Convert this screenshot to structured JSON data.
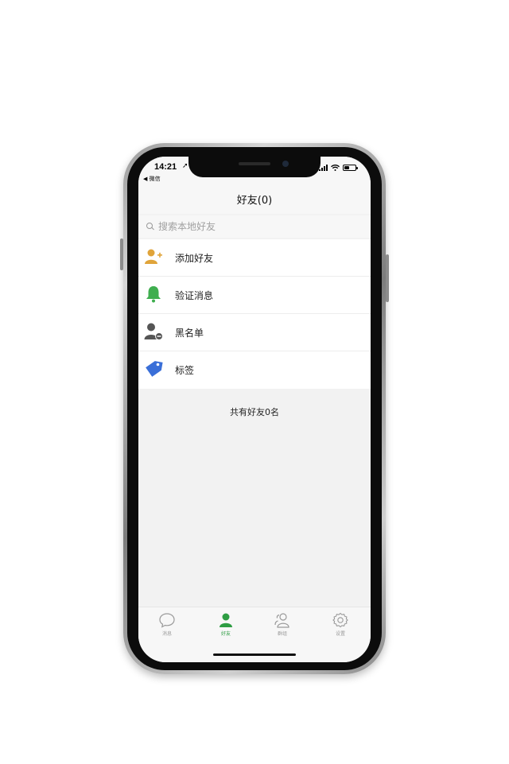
{
  "status_bar": {
    "time": "14:21",
    "location_glyph": "➚",
    "back_app": "◀ 微信"
  },
  "header": {
    "title": "好友(0)"
  },
  "search": {
    "placeholder": "搜索本地好友"
  },
  "menu": [
    {
      "label": "添加好友",
      "icon": "add-friend-icon",
      "color": "#e0a43a"
    },
    {
      "label": "验证消息",
      "icon": "bell-icon",
      "color": "#3fae4f"
    },
    {
      "label": "黑名单",
      "icon": "blocked-user-icon",
      "color": "#555555"
    },
    {
      "label": "标签",
      "icon": "tag-icon",
      "color": "#3a6fd8"
    }
  ],
  "summary": {
    "friend_count_text": "共有好友0名"
  },
  "tabs": [
    {
      "label": "消息",
      "icon": "chat-bubble-icon",
      "active": false
    },
    {
      "label": "好友",
      "icon": "person-icon",
      "active": true
    },
    {
      "label": "群组",
      "icon": "group-icon",
      "active": false
    },
    {
      "label": "设置",
      "icon": "gear-icon",
      "active": false
    }
  ],
  "colors": {
    "accent": "#2e9d43",
    "inactive_tab": "#9a9a9a"
  }
}
